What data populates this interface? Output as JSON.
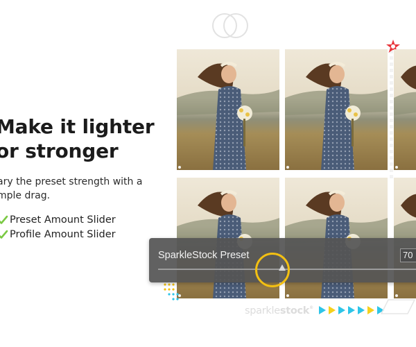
{
  "hero": {
    "headline_line1": "Make it lighter",
    "headline_line2": "or stronger",
    "subtext_line1": "ary the preset strength with a",
    "subtext_line2": "mple drag."
  },
  "features": [
    {
      "label": "Preset Amount Slider",
      "icon": "checkmark-icon"
    },
    {
      "label": "Profile Amount Slider",
      "icon": "checkmark-icon"
    }
  ],
  "slider_panel": {
    "label": "SparkleStock Preset",
    "value": "70",
    "level": 0.48
  },
  "brand": {
    "name_light": "sparkle",
    "name_bold": "stock",
    "mark": "®"
  },
  "colors": {
    "accent_yellow": "#f3c012",
    "check_green": "#7ac943",
    "arrow_cyan": "#2ec5e8",
    "arrow_yellow": "#f6d11c",
    "star_red": "#e8373d",
    "panel_bg": "#555555"
  }
}
